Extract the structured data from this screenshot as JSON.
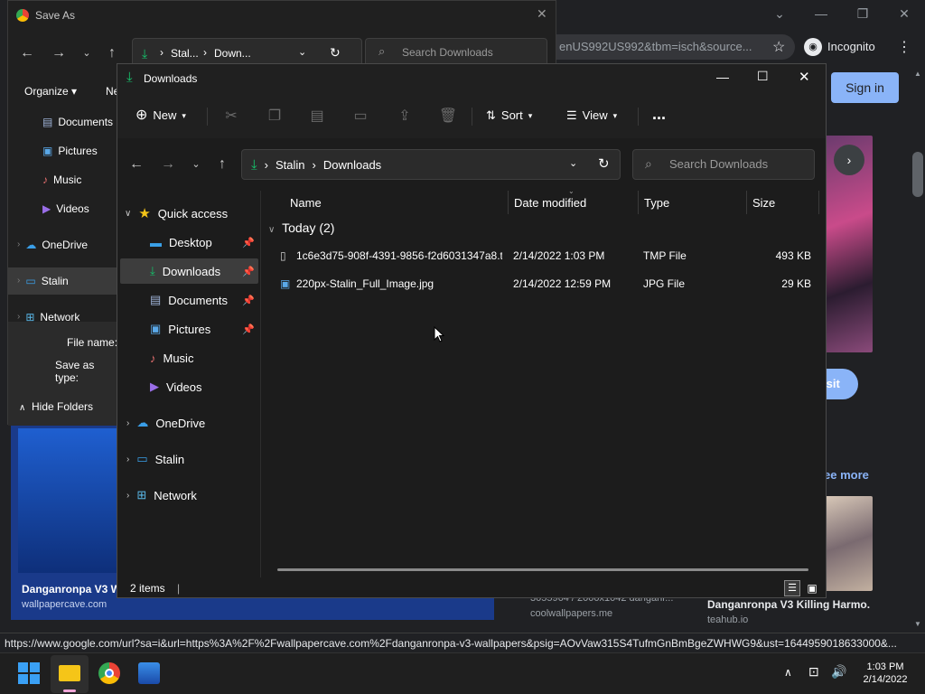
{
  "chrome": {
    "omnibox_url": "enUS992US992&tbm=isch&source...",
    "incognito_label": "Incognito",
    "sign_in_label": "Sign in",
    "visit_label": "isit",
    "see_more_label": "ee more",
    "cards": [
      {
        "title": "Danganronpa V3 W",
        "source": "wallpapercave.com"
      },
      {
        "title": "",
        "source": "coolwallpapers.me",
        "dims": "3055964 / 2000x1042 danganr..."
      },
      {
        "title": "Danganronpa V3 Killing Harmo...",
        "source": "teahub.io"
      }
    ],
    "status_url": "https://www.google.com/url?sa=i&url=https%3A%2F%2Fwallpapercave.com%2Fdanganronpa-v3-wallpapers&psig=AOvVaw315S4TufmGnBmBgeZWHWG9&ust=1644959018633000&..."
  },
  "save_as": {
    "title": "Save As",
    "organize_label": "Organize",
    "new_label": "Ne",
    "address": {
      "part1": "Stal...",
      "part2": "Down..."
    },
    "search_placeholder": "Search Downloads",
    "nav": [
      {
        "label": "Documents",
        "icon": "documents-icon"
      },
      {
        "label": "Pictures",
        "icon": "pictures-icon"
      },
      {
        "label": "Music",
        "icon": "music-icon"
      },
      {
        "label": "Videos",
        "icon": "videos-icon"
      },
      {
        "label": "OneDrive",
        "icon": "onedrive-icon"
      },
      {
        "label": "Stalin",
        "icon": "pc-icon"
      },
      {
        "label": "Network",
        "icon": "network-icon"
      }
    ],
    "file_name_label": "File name:",
    "save_as_type_label": "Save as type:",
    "hide_folders_label": "Hide Folders"
  },
  "explorer": {
    "title": "Downloads",
    "toolbar": {
      "new_label": "New",
      "sort_label": "Sort",
      "view_label": "View",
      "more_label": "..."
    },
    "address": {
      "part1": "Stalin",
      "part2": "Downloads"
    },
    "search_placeholder": "Search Downloads",
    "sidebar": {
      "quick_access": "Quick access",
      "items": [
        {
          "label": "Desktop",
          "icon": "desktop-icon",
          "pinned": true
        },
        {
          "label": "Downloads",
          "icon": "downloads-icon",
          "pinned": true
        },
        {
          "label": "Documents",
          "icon": "documents-icon",
          "pinned": true
        },
        {
          "label": "Pictures",
          "icon": "pictures-icon",
          "pinned": true
        },
        {
          "label": "Music",
          "icon": "music-icon",
          "pinned": false
        },
        {
          "label": "Videos",
          "icon": "videos-icon",
          "pinned": false
        }
      ],
      "onedrive": "OneDrive",
      "pc": "Stalin",
      "network": "Network"
    },
    "columns": {
      "name": "Name",
      "date": "Date modified",
      "type": "Type",
      "size": "Size"
    },
    "group_label": "Today (2)",
    "files": [
      {
        "name": "1c6e3d75-908f-4391-9856-f2d6031347a8.t...",
        "date": "2/14/2022 1:03 PM",
        "type": "TMP File",
        "size": "493 KB"
      },
      {
        "name": "220px-Stalin_Full_Image.jpg",
        "date": "2/14/2022 12:59 PM",
        "type": "JPG File",
        "size": "29 KB"
      }
    ],
    "status": "2 items",
    "accent": "#15c26b"
  },
  "taskbar": {
    "time": "1:03 PM",
    "date": "2/14/2022"
  }
}
